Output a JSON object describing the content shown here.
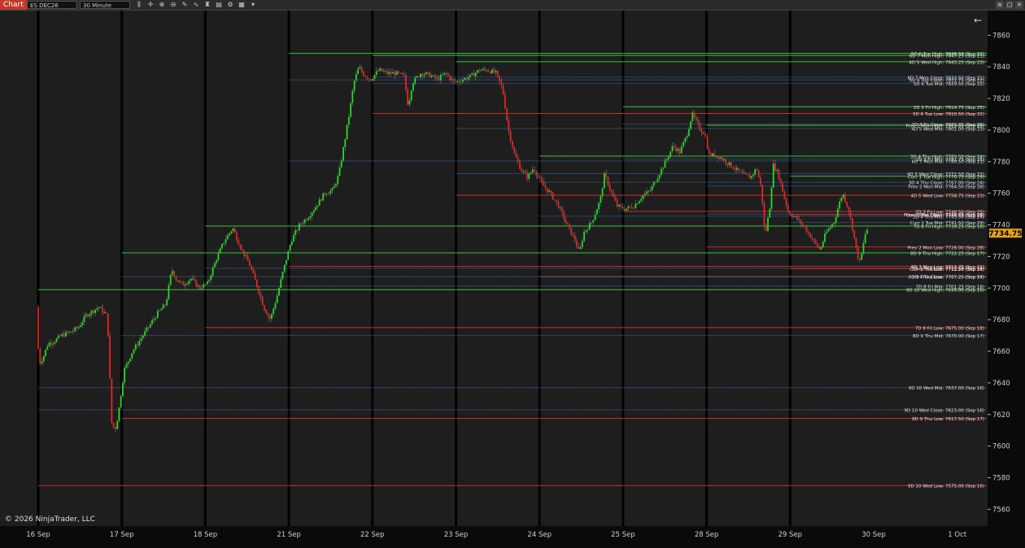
{
  "toolbar": {
    "app_label": "Chart",
    "instrument": "ES DEC26",
    "timeframe": "30 Minute",
    "icons": [
      "bars-icon",
      "cross-icon",
      "zoom-in-icon",
      "zoom-out-icon",
      "draw-icon",
      "indicator-icon",
      "strategy-icon",
      "template-icon",
      "properties-icon",
      "data-box-icon",
      "more-icon"
    ],
    "window_buttons": [
      "≡",
      "▢",
      "✕"
    ]
  },
  "chart_data": {
    "type": "candlestick",
    "copyright": "© 2026 NinjaTrader, LLC",
    "last_price": "7734.75",
    "back_arrow": "←",
    "y_ticks": [
      7560,
      7580,
      7600,
      7620,
      7640,
      7660,
      7680,
      7700,
      7720,
      7740,
      7760,
      7780,
      7800,
      7820,
      7840,
      7860
    ],
    "ylim": [
      7553,
      7872
    ],
    "x_labels": [
      "16 Sep",
      "17 Sep",
      "18 Sep",
      "21 Sep",
      "22 Sep",
      "23 Sep",
      "24 Sep",
      "25 Sep",
      "28 Sep",
      "29 Sep",
      "30 Sep",
      "1 Oct"
    ],
    "colors": {
      "up": "#22dd22",
      "down": "#ee2222",
      "line_green": "#3fbf3f",
      "line_red": "#cc2a2a",
      "line_blue": "#3a6fa8",
      "session": "#000000",
      "bg": "#1e1e1e",
      "price_tag": "#e8a317"
    },
    "path": [
      [
        0,
        7688
      ],
      [
        0.03,
        7652
      ],
      [
        0.08,
        7656
      ],
      [
        0.14,
        7665
      ],
      [
        0.2,
        7666
      ],
      [
        0.3,
        7670
      ],
      [
        0.4,
        7672
      ],
      [
        0.5,
        7675
      ],
      [
        0.6,
        7683
      ],
      [
        0.75,
        7688
      ],
      [
        0.85,
        7682
      ],
      [
        0.9,
        7615
      ],
      [
        0.94,
        7610
      ],
      [
        0.98,
        7620
      ],
      [
        1.05,
        7648
      ],
      [
        1.15,
        7660
      ],
      [
        1.25,
        7668
      ],
      [
        1.35,
        7676
      ],
      [
        1.45,
        7684
      ],
      [
        1.55,
        7690
      ],
      [
        1.62,
        7712
      ],
      [
        1.68,
        7705
      ],
      [
        1.75,
        7702
      ],
      [
        1.85,
        7706
      ],
      [
        1.95,
        7700
      ],
      [
        2.05,
        7703
      ],
      [
        2.15,
        7718
      ],
      [
        2.25,
        7730
      ],
      [
        2.35,
        7738
      ],
      [
        2.45,
        7725
      ],
      [
        2.55,
        7715
      ],
      [
        2.65,
        7700
      ],
      [
        2.72,
        7688
      ],
      [
        2.8,
        7680
      ],
      [
        2.88,
        7695
      ],
      [
        2.95,
        7710
      ],
      [
        3.05,
        7730
      ],
      [
        3.15,
        7740
      ],
      [
        3.25,
        7745
      ],
      [
        3.35,
        7752
      ],
      [
        3.45,
        7760
      ],
      [
        3.55,
        7762
      ],
      [
        3.62,
        7772
      ],
      [
        3.68,
        7790
      ],
      [
        3.75,
        7812
      ],
      [
        3.8,
        7830
      ],
      [
        3.86,
        7840
      ],
      [
        3.92,
        7835
      ],
      [
        4.0,
        7832
      ],
      [
        4.1,
        7838
      ],
      [
        4.2,
        7836
      ],
      [
        4.3,
        7836
      ],
      [
        4.4,
        7834
      ],
      [
        4.45,
        7815
      ],
      [
        4.5,
        7830
      ],
      [
        4.6,
        7836
      ],
      [
        4.7,
        7835
      ],
      [
        4.8,
        7832
      ],
      [
        4.9,
        7836
      ],
      [
        5.0,
        7830
      ],
      [
        5.1,
        7832
      ],
      [
        5.2,
        7834
      ],
      [
        5.3,
        7838
      ],
      [
        5.4,
        7838
      ],
      [
        5.5,
        7836
      ],
      [
        5.58,
        7826
      ],
      [
        5.65,
        7800
      ],
      [
        5.72,
        7785
      ],
      [
        5.8,
        7775
      ],
      [
        5.88,
        7770
      ],
      [
        5.95,
        7776
      ],
      [
        6.05,
        7766
      ],
      [
        6.15,
        7760
      ],
      [
        6.25,
        7752
      ],
      [
        6.35,
        7740
      ],
      [
        6.45,
        7730
      ],
      [
        6.5,
        7722
      ],
      [
        6.55,
        7735
      ],
      [
        6.65,
        7742
      ],
      [
        6.75,
        7756
      ],
      [
        6.8,
        7772
      ],
      [
        6.85,
        7765
      ],
      [
        6.9,
        7758
      ],
      [
        6.95,
        7752
      ],
      [
        7.05,
        7750
      ],
      [
        7.15,
        7752
      ],
      [
        7.25,
        7758
      ],
      [
        7.35,
        7762
      ],
      [
        7.45,
        7772
      ],
      [
        7.55,
        7782
      ],
      [
        7.62,
        7790
      ],
      [
        7.7,
        7786
      ],
      [
        7.78,
        7796
      ],
      [
        7.85,
        7810
      ],
      [
        7.9,
        7805
      ],
      [
        7.95,
        7800
      ],
      [
        8.0,
        7798
      ],
      [
        8.05,
        7784
      ],
      [
        8.15,
        7784
      ],
      [
        8.25,
        7780
      ],
      [
        8.35,
        7776
      ],
      [
        8.45,
        7772
      ],
      [
        8.55,
        7770
      ],
      [
        8.62,
        7776
      ],
      [
        8.68,
        7762
      ],
      [
        8.72,
        7732
      ],
      [
        8.78,
        7752
      ],
      [
        8.82,
        7778
      ],
      [
        8.88,
        7772
      ],
      [
        8.95,
        7758
      ],
      [
        9.0,
        7748
      ],
      [
        9.1,
        7744
      ],
      [
        9.2,
        7738
      ],
      [
        9.3,
        7730
      ],
      [
        9.38,
        7724
      ],
      [
        9.45,
        7735
      ],
      [
        9.55,
        7742
      ],
      [
        9.6,
        7752
      ],
      [
        9.65,
        7760
      ],
      [
        9.72,
        7750
      ],
      [
        9.78,
        7735
      ],
      [
        9.82,
        7722
      ],
      [
        9.86,
        7716
      ],
      [
        9.92,
        7734
      ],
      [
        9.95,
        7738
      ]
    ],
    "levels": [
      {
        "label": "5D 6 Tue High: 7848.50 (Sep 22)",
        "value": 7848.5,
        "start": 3,
        "color": "green",
        "style": "solid"
      },
      {
        "label": "6D 7 Mon High: 7847.25 (Sep 21)",
        "value": 7847.25,
        "start": 4,
        "color": "green",
        "style": "solid"
      },
      {
        "label": "4D 5 Wed High: 7843.25 (Sep 23)",
        "value": 7843.25,
        "start": 5,
        "color": "green",
        "style": "solid"
      },
      {
        "label": "6D 7 Mon Close: 7833.50 (Sep 21)",
        "value": 7833.5,
        "start": 4,
        "color": "blue",
        "style": "dotted"
      },
      {
        "label": "5D 6 Tue Close: 7831.75 (Sep 22)",
        "value": 7831.75,
        "start": 3,
        "color": "blue",
        "style": "dotted"
      },
      {
        "label": "5D 6 Tue Mid: 7829.50 (Sep 22)",
        "value": 7829.5,
        "start": 4,
        "color": "blue",
        "style": "dotted"
      },
      {
        "label": "2D 3 Fri High: 7814.75 (Sep 25)",
        "value": 7814.75,
        "start": 7,
        "color": "green",
        "style": "solid"
      },
      {
        "label": "5D 6 Tue Low: 7810.50 (Sep 22)",
        "value": 7810.5,
        "start": 4,
        "color": "red",
        "style": "solid"
      },
      {
        "label": "2D 3 Fri Close: 7803.75 (Sep 25)",
        "value": 7803.75,
        "start": 7,
        "color": "blue",
        "style": "dotted"
      },
      {
        "label": "Prev 2 Mon High: 7803.00 (Sep 28)",
        "value": 7803,
        "start": 8,
        "color": "green",
        "style": "solid"
      },
      {
        "label": "4D 5 Wed Mid: 7801.00 (Sep 23)",
        "value": 7801,
        "start": 5,
        "color": "blue",
        "style": "dotted"
      },
      {
        "label": "3D 4 Thu High: 7783.50 (Sep 24)",
        "value": 7783.5,
        "start": 6,
        "color": "green",
        "style": "solid"
      },
      {
        "label": "2D 3 Fri Mid: 7781.75 (Sep 25)",
        "value": 7781.75,
        "start": 7,
        "color": "blue",
        "style": "dotted"
      },
      {
        "label": "6D 7 Mon Mid: 7780.50 (Sep 21)",
        "value": 7780.5,
        "start": 3,
        "color": "blue",
        "style": "dotted"
      },
      {
        "label": "4D 5 Wed Close: 7772.50 (Sep 23)",
        "value": 7772.5,
        "start": 5,
        "color": "blue",
        "style": "dotted"
      },
      {
        "label": "Curr 1 Tue High: 7770.75 (Sep 29)",
        "value": 7770.75,
        "start": 9,
        "color": "green",
        "style": "solid"
      },
      {
        "label": "3D 4 Thu Close: 7767.00 (Sep 24)",
        "value": 7767,
        "start": 6,
        "color": "blue",
        "style": "dotted"
      },
      {
        "label": "Prev 2 Mon Mid: 7764.50 (Sep 28)",
        "value": 7764.5,
        "start": 8,
        "color": "blue",
        "style": "dotted"
      },
      {
        "label": "4D 5 Wed Low: 7758.75 (Sep 23)",
        "value": 7758.75,
        "start": 5,
        "color": "red",
        "style": "solid"
      },
      {
        "label": "2D 3 Fri Low: 7748.50 (Sep 25)",
        "value": 7748.5,
        "start": 7,
        "color": "red",
        "style": "solid"
      },
      {
        "label": "Prev 2 Mon Close: 7746.75 (Sep 28)",
        "value": 7746.75,
        "start": 8,
        "color": "blue",
        "style": "dotted"
      },
      {
        "label": "Curr 1 Tue Open: 7746.50 (Sep 29)",
        "value": 7746.5,
        "start": 9,
        "color": "red",
        "style": "solid"
      },
      {
        "label": "3D 4 Thu Mid: 7745.50 (Sep 24)",
        "value": 7745.5,
        "start": 6,
        "color": "blue",
        "style": "dotted"
      },
      {
        "label": "Curr 1 Tue Mid: 7741.50 (Sep 29)",
        "value": 7741.5,
        "start": 9,
        "color": "blue",
        "style": "dotted"
      },
      {
        "label": "7D 8 Fri High: 7739.25 (Sep 18)",
        "value": 7739.25,
        "start": 2,
        "color": "green",
        "style": "solid"
      },
      {
        "label": "Prev 2 Mon Low: 7726.00 (Sep 28)",
        "value": 7726,
        "start": 8,
        "color": "red",
        "style": "solid"
      },
      {
        "label": "8D 9 Thu High: 7722.25 (Sep 17)",
        "value": 7722.25,
        "start": 1,
        "color": "green",
        "style": "solid"
      },
      {
        "label": "6D 7 Mon Low: 7713.75 (Sep 21)",
        "value": 7713.75,
        "start": 3,
        "color": "red",
        "style": "solid"
      },
      {
        "label": "7D 8 Fri Close: 7712.50 (Sep 18)",
        "value": 7712.5,
        "start": 2,
        "color": "blue",
        "style": "dotted"
      },
      {
        "label": "Curr 1 Tue Low: 7712.25 (Sep 29)",
        "value": 7712.25,
        "start": 9,
        "color": "red",
        "style": "solid"
      },
      {
        "label": "3D 4 Thu Low: 7707.25 (Sep 24)",
        "value": 7707.25,
        "start": 6,
        "color": "red",
        "style": "solid"
      },
      {
        "label": "8D 9 Thu Close: 7707.25 (Sep 17)",
        "value": 7707.25,
        "start": 1,
        "color": "blue",
        "style": "dotted"
      },
      {
        "label": "7D 8 Fri Mid: 7701.25 (Sep 18)",
        "value": 7701.25,
        "start": 2,
        "color": "blue",
        "style": "dotted"
      },
      {
        "label": "9D 10 Wed High: 7699.00 (Sep 16)",
        "value": 7699,
        "start": 0,
        "color": "green",
        "style": "solid"
      },
      {
        "label": "7D 8 Fri Low: 7675.00 (Sep 18)",
        "value": 7675,
        "start": 2,
        "color": "red",
        "style": "solid"
      },
      {
        "label": "8D 9 Thu Mid: 7670.00 (Sep 17)",
        "value": 7670,
        "start": 1,
        "color": "blue",
        "style": "dotted"
      },
      {
        "label": "9D 10 Wed Mid: 7637.00 (Sep 16)",
        "value": 7637,
        "start": 0,
        "color": "blue",
        "style": "dotted"
      },
      {
        "label": "9D 10 Wed Close: 7623.00 (Sep 16)",
        "value": 7623,
        "start": 0,
        "color": "blue",
        "style": "dotted"
      },
      {
        "label": "8D 9 Thu Low: 7617.50 (Sep 17)",
        "value": 7617.5,
        "start": 1,
        "color": "red",
        "style": "solid"
      },
      {
        "label": "9D 10 Wed Low: 7575.00 (Sep 16)",
        "value": 7575,
        "start": 0,
        "color": "red",
        "style": "solid"
      }
    ]
  }
}
